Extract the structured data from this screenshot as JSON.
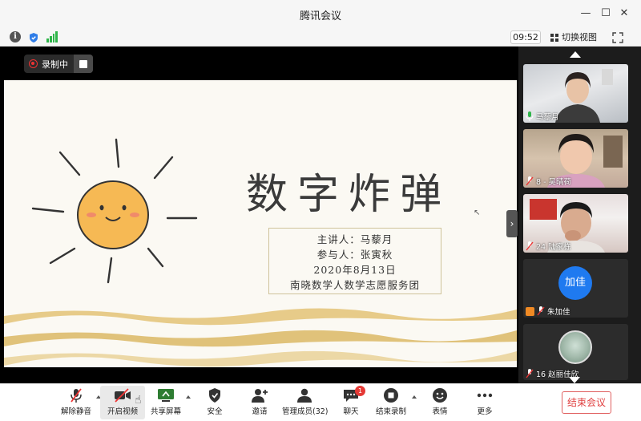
{
  "window": {
    "title": "腾讯会议"
  },
  "infobar": {
    "time": "09:52",
    "switch_view": "切换视图"
  },
  "recording": {
    "label": "录制中"
  },
  "slide": {
    "title": "数字炸弹",
    "speaker": "主讲人：马藜月",
    "participant": "参与人：张寅秋",
    "date": "2020年8月13日",
    "org": "南晓数学人数学志愿服务团"
  },
  "participants": [
    {
      "name": "马藜月",
      "mic": "on"
    },
    {
      "name": "8 - 吴晴荷",
      "mic": "muted"
    },
    {
      "name": "24 陆家栋",
      "mic": "muted"
    },
    {
      "name": "朱加佳",
      "avatar_text": "加佳",
      "mic": "muted"
    },
    {
      "name": "16  赵丽佳欣",
      "mic": "muted"
    }
  ],
  "toolbar": {
    "unmute": "解除静音",
    "start_video": "开启视频",
    "share_screen": "共享屏幕",
    "security": "安全",
    "invite": "邀请",
    "manage_members": "管理成员(32)",
    "chat": "聊天",
    "chat_badge": "1",
    "end_recording": "结束录制",
    "reactions": "表情",
    "more": "更多",
    "end_meeting": "结束会议"
  },
  "colors": {
    "accent": "#1f7af0",
    "record": "#e33333",
    "end": "#e04040",
    "signal": "#2fb54a"
  }
}
